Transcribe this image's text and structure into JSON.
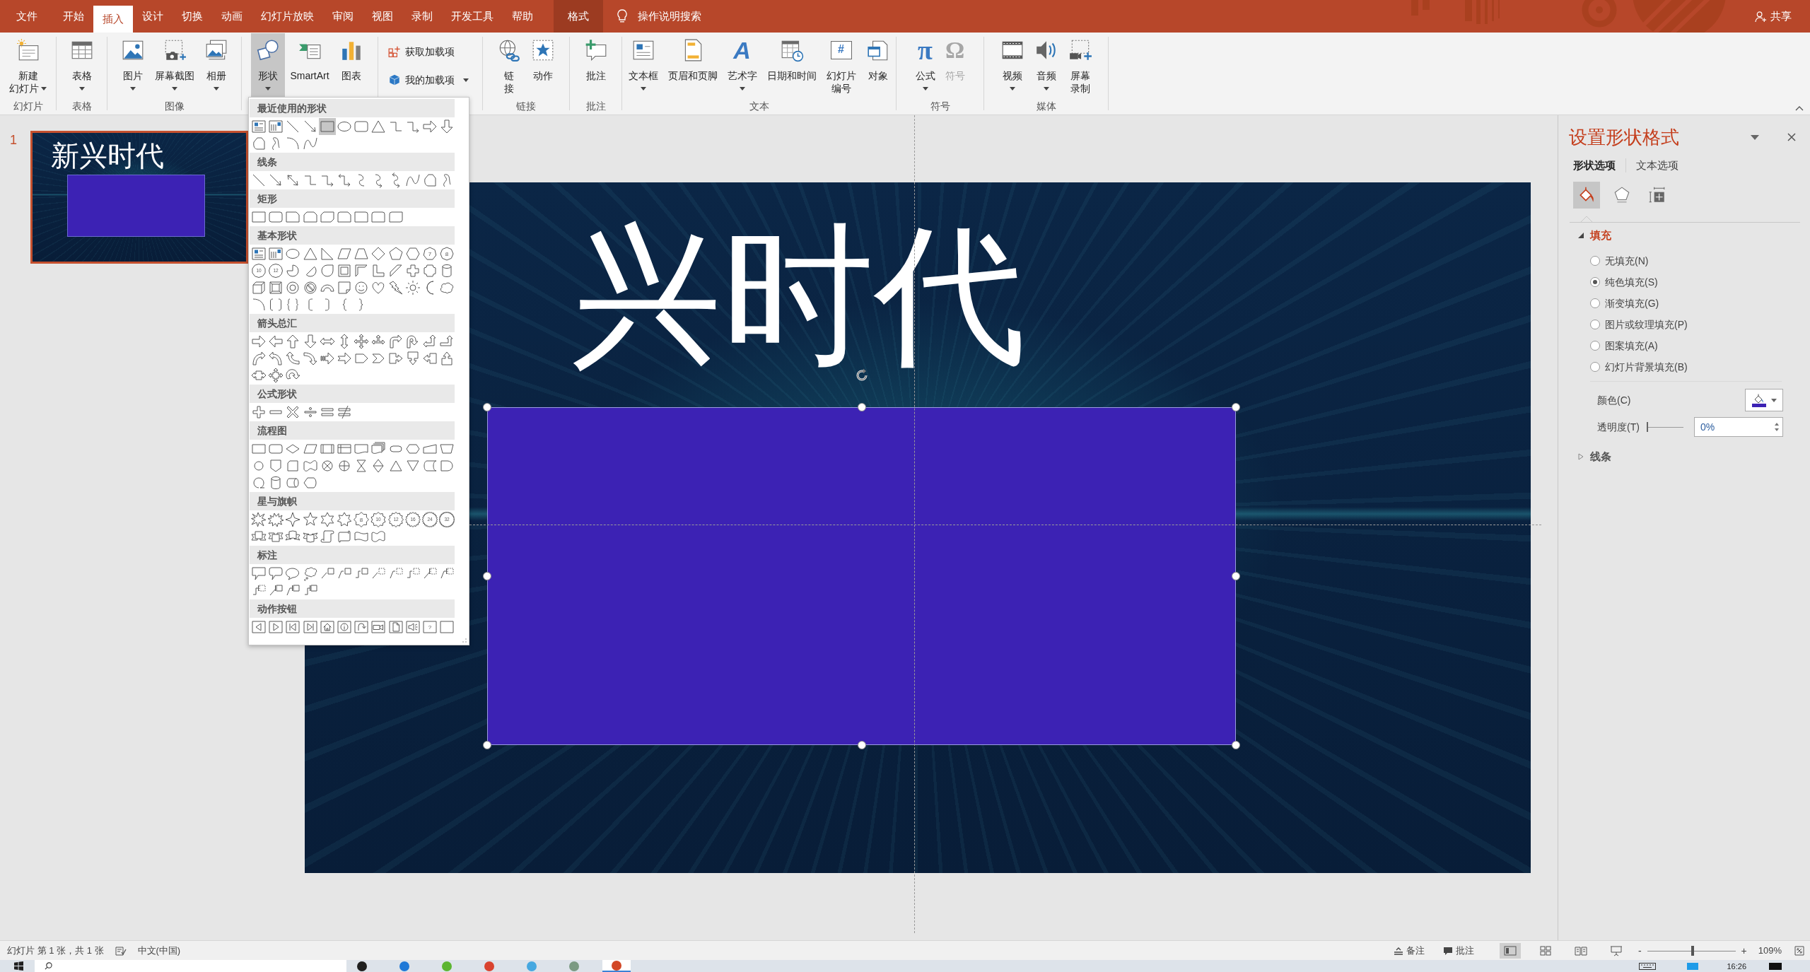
{
  "menu_tabs": [
    {
      "label": "文件",
      "kind": "file",
      "selected": false
    },
    {
      "label": "开始",
      "kind": "normal",
      "selected": false
    },
    {
      "label": "插入",
      "kind": "normal",
      "selected": true
    },
    {
      "label": "设计",
      "kind": "normal",
      "selected": false
    },
    {
      "label": "切换",
      "kind": "normal",
      "selected": false
    },
    {
      "label": "动画",
      "kind": "normal",
      "selected": false
    },
    {
      "label": "幻灯片放映",
      "kind": "normal",
      "selected": false
    },
    {
      "label": "审阅",
      "kind": "normal",
      "selected": false
    },
    {
      "label": "视图",
      "kind": "normal",
      "selected": false
    },
    {
      "label": "录制",
      "kind": "normal",
      "selected": false
    },
    {
      "label": "开发工具",
      "kind": "normal",
      "selected": false
    },
    {
      "label": "帮助",
      "kind": "normal",
      "selected": false
    },
    {
      "label": "格式",
      "kind": "contextual",
      "selected": false
    }
  ],
  "tell_me": "操作说明搜索",
  "share": "共享",
  "ribbon_groups": [
    {
      "label": "幻灯片",
      "items": [
        {
          "kind": "new_slide",
          "lines": [
            "新建",
            "幻灯片"
          ],
          "dropdown": true,
          "pressed": false,
          "disabled": false
        }
      ]
    },
    {
      "label": "表格",
      "items": [
        {
          "kind": "table",
          "lines": [
            "表格"
          ],
          "dropdown": true,
          "pressed": false,
          "disabled": false
        }
      ]
    },
    {
      "label": "图像",
      "items": [
        {
          "kind": "picture",
          "lines": [
            "图片"
          ],
          "dropdown": true,
          "pressed": false,
          "disabled": false
        },
        {
          "kind": "screenshot",
          "lines": [
            "屏幕截图"
          ],
          "dropdown": true,
          "pressed": false,
          "disabled": false
        },
        {
          "kind": "album",
          "lines": [
            "相册"
          ],
          "dropdown": true,
          "pressed": false,
          "disabled": false
        }
      ]
    },
    {
      "items": [
        {
          "kind": "shapes",
          "lines": [
            "形状"
          ],
          "dropdown": true,
          "pressed": true,
          "disabled": false
        },
        {
          "kind": "smartart",
          "lines": [
            "SmartArt"
          ],
          "dropdown": false,
          "pressed": false,
          "disabled": false
        },
        {
          "kind": "chart",
          "lines": [
            "图表"
          ],
          "dropdown": false,
          "pressed": false,
          "disabled": false
        }
      ]
    },
    {
      "items": [
        {
          "kind": "store",
          "lines": [
            "获取加载项"
          ],
          "dropdown": false,
          "pressed": false,
          "disabled": false
        },
        {
          "kind": "addins",
          "lines": [
            "我的加载项"
          ],
          "dropdown": true,
          "pressed": false,
          "disabled": false
        }
      ]
    },
    {
      "label": "链接",
      "items": [
        {
          "kind": "link",
          "lines": [
            "链",
            "接"
          ],
          "dropdown": false,
          "pressed": false,
          "disabled": false
        },
        {
          "kind": "action",
          "lines": [
            "动作"
          ],
          "dropdown": false,
          "pressed": false,
          "disabled": false
        }
      ]
    },
    {
      "label": "批注",
      "items": [
        {
          "kind": "comment",
          "lines": [
            "批注"
          ],
          "dropdown": false,
          "pressed": false,
          "disabled": false
        }
      ]
    },
    {
      "label": "文本",
      "items": [
        {
          "kind": "textbox",
          "lines": [
            "文本框"
          ],
          "dropdown": true,
          "pressed": false,
          "disabled": false
        },
        {
          "kind": "header_footer",
          "lines": [
            "页眉和页脚"
          ],
          "dropdown": false,
          "pressed": false,
          "disabled": false
        },
        {
          "kind": "wordart",
          "glyph": "A",
          "lines": [
            "艺术字"
          ],
          "dropdown": true,
          "pressed": false,
          "disabled": false
        },
        {
          "kind": "datetime",
          "lines": [
            "日期和时间"
          ],
          "dropdown": false,
          "pressed": false,
          "disabled": false
        },
        {
          "kind": "slide_number",
          "glyph": "#",
          "lines": [
            "幻灯片",
            "编号"
          ],
          "dropdown": false,
          "pressed": false,
          "disabled": false
        },
        {
          "kind": "object",
          "lines": [
            "对象"
          ],
          "dropdown": false,
          "pressed": false,
          "disabled": false
        }
      ]
    },
    {
      "label": "符号",
      "items": [
        {
          "kind": "equation",
          "glyph": "π",
          "lines": [
            "公式"
          ],
          "dropdown": true,
          "pressed": false,
          "disabled": false
        },
        {
          "kind": "symbol",
          "glyph": "Ω",
          "lines": [
            "符号"
          ],
          "dropdown": false,
          "pressed": false,
          "disabled": true
        }
      ]
    },
    {
      "label": "媒体",
      "items": [
        {
          "kind": "video",
          "lines": [
            "视频"
          ],
          "dropdown": true,
          "pressed": false,
          "disabled": false
        },
        {
          "kind": "audio",
          "lines": [
            "音频"
          ],
          "dropdown": true,
          "pressed": false,
          "disabled": false
        },
        {
          "kind": "screen_recording",
          "lines": [
            "屏幕",
            "录制"
          ],
          "dropdown": false,
          "pressed": false,
          "disabled": false
        }
      ]
    }
  ],
  "gallery": {
    "sections": [
      {
        "title": "最近使用的形状",
        "shapes": [
          {
            "kind": "textbox",
            "selected": false
          },
          {
            "kind": "vtextbox",
            "selected": false
          },
          {
            "kind": "line",
            "selected": false
          },
          {
            "kind": "arrowline",
            "selected": false
          },
          {
            "kind": "rect",
            "selected": true
          },
          {
            "kind": "oval",
            "selected": false
          },
          {
            "kind": "roundrect",
            "selected": false
          },
          {
            "kind": "triangle",
            "selected": false
          },
          {
            "kind": "elbow",
            "selected": false
          },
          {
            "kind": "elbowarrow",
            "selected": false
          },
          {
            "kind": "arrowright",
            "selected": false
          },
          {
            "kind": "arrowdown",
            "selected": false
          },
          {
            "kind": "freeform",
            "selected": false
          },
          {
            "kind": "scribble",
            "selected": false
          },
          {
            "kind": "arc",
            "selected": false
          },
          {
            "kind": "curve",
            "selected": false
          }
        ]
      },
      {
        "title": "线条",
        "shapes": [
          {
            "kind": "line"
          },
          {
            "kind": "arrowline"
          },
          {
            "kind": "dblarrowline"
          },
          {
            "kind": "elbow"
          },
          {
            "kind": "elbowarrow"
          },
          {
            "kind": "elbowdbl"
          },
          {
            "kind": "curveconn"
          },
          {
            "kind": "curvearrow"
          },
          {
            "kind": "curvedbl"
          },
          {
            "kind": "curve"
          },
          {
            "kind": "freeform"
          },
          {
            "kind": "scribble"
          }
        ]
      },
      {
        "title": "矩形",
        "shapes": [
          {
            "kind": "rect"
          },
          {
            "kind": "roundrect"
          },
          {
            "kind": "snip1"
          },
          {
            "kind": "snip2"
          },
          {
            "kind": "snipdiag"
          },
          {
            "kind": "sniprnd"
          },
          {
            "kind": "round1"
          },
          {
            "kind": "round2"
          },
          {
            "kind": "rounddiag"
          }
        ]
      },
      {
        "title": "基本形状",
        "shapes": [
          {
            "kind": "textbox"
          },
          {
            "kind": "vtextbox"
          },
          {
            "kind": "oval"
          },
          {
            "kind": "triangle"
          },
          {
            "kind": "rtriangle"
          },
          {
            "kind": "parallelogram"
          },
          {
            "kind": "trapezoid"
          },
          {
            "kind": "diamond"
          },
          {
            "kind": "pentagon"
          },
          {
            "kind": "hexagon"
          },
          {
            "kind": "heptagon",
            "label": "7"
          },
          {
            "kind": "octagon",
            "label": "8"
          },
          {
            "kind": "decagon",
            "label": "10"
          },
          {
            "kind": "dodecagon",
            "label": "12"
          },
          {
            "kind": "pie"
          },
          {
            "kind": "chord"
          },
          {
            "kind": "teardrop"
          },
          {
            "kind": "frame"
          },
          {
            "kind": "halfframe"
          },
          {
            "kind": "lshape"
          },
          {
            "kind": "diagstripe"
          },
          {
            "kind": "cross"
          },
          {
            "kind": "plaque"
          },
          {
            "kind": "can"
          },
          {
            "kind": "cube"
          },
          {
            "kind": "bevel"
          },
          {
            "kind": "donut"
          },
          {
            "kind": "nosymbol"
          },
          {
            "kind": "blockarc"
          },
          {
            "kind": "foldedcorner"
          },
          {
            "kind": "smiley"
          },
          {
            "kind": "heart"
          },
          {
            "kind": "lightning"
          },
          {
            "kind": "sun"
          },
          {
            "kind": "moon"
          },
          {
            "kind": "cloud"
          },
          {
            "kind": "arc"
          },
          {
            "kind": "bracketpair"
          },
          {
            "kind": "bracepair"
          },
          {
            "kind": "lbracket"
          },
          {
            "kind": "rbracket"
          },
          {
            "kind": "lbrace"
          },
          {
            "kind": "rbrace"
          }
        ]
      },
      {
        "title": "箭头总汇",
        "shapes": [
          {
            "kind": "arrowright"
          },
          {
            "kind": "arrowleft"
          },
          {
            "kind": "arrowup"
          },
          {
            "kind": "arrowdown"
          },
          {
            "kind": "arrowlr"
          },
          {
            "kind": "arrowud"
          },
          {
            "kind": "arrowquad"
          },
          {
            "kind": "arrowlru"
          },
          {
            "kind": "bentarrow"
          },
          {
            "kind": "uturn"
          },
          {
            "kind": "leftup"
          },
          {
            "kind": "bentup"
          },
          {
            "kind": "curvedright"
          },
          {
            "kind": "curvedleft"
          },
          {
            "kind": "curvedup"
          },
          {
            "kind": "curveddown"
          },
          {
            "kind": "striped"
          },
          {
            "kind": "notched"
          },
          {
            "kind": "homeplate"
          },
          {
            "kind": "chevron"
          },
          {
            "kind": "calloutright"
          },
          {
            "kind": "calloutdown"
          },
          {
            "kind": "calloutleft"
          },
          {
            "kind": "calloutup"
          },
          {
            "kind": "calloutlr"
          },
          {
            "kind": "calloutquad"
          },
          {
            "kind": "circulararrow"
          }
        ]
      },
      {
        "title": "公式形状",
        "shapes": [
          {
            "kind": "plus"
          },
          {
            "kind": "minus"
          },
          {
            "kind": "multiply"
          },
          {
            "kind": "divide"
          },
          {
            "kind": "equal"
          },
          {
            "kind": "notequal"
          }
        ]
      },
      {
        "title": "流程图",
        "shapes": [
          {
            "kind": "process"
          },
          {
            "kind": "altprocess"
          },
          {
            "kind": "decision"
          },
          {
            "kind": "data"
          },
          {
            "kind": "predefined"
          },
          {
            "kind": "internal"
          },
          {
            "kind": "document"
          },
          {
            "kind": "multidoc"
          },
          {
            "kind": "terminator"
          },
          {
            "kind": "preparation"
          },
          {
            "kind": "manualinput"
          },
          {
            "kind": "manualop"
          },
          {
            "kind": "connector"
          },
          {
            "kind": "offpage"
          },
          {
            "kind": "card"
          },
          {
            "kind": "punchedtape"
          },
          {
            "kind": "summing"
          },
          {
            "kind": "or"
          },
          {
            "kind": "collate"
          },
          {
            "kind": "sort"
          },
          {
            "kind": "extract"
          },
          {
            "kind": "merge"
          },
          {
            "kind": "storeddata"
          },
          {
            "kind": "delay"
          },
          {
            "kind": "sequential"
          },
          {
            "kind": "magdisk"
          },
          {
            "kind": "directaccess"
          },
          {
            "kind": "display"
          }
        ]
      },
      {
        "title": "星与旗帜",
        "shapes": [
          {
            "kind": "explosion1"
          },
          {
            "kind": "explosion2"
          },
          {
            "kind": "star4"
          },
          {
            "kind": "star5"
          },
          {
            "kind": "star6"
          },
          {
            "kind": "star7"
          },
          {
            "kind": "seal8",
            "label": "8"
          },
          {
            "kind": "seal10",
            "label": "10"
          },
          {
            "kind": "seal12",
            "label": "12"
          },
          {
            "kind": "seal16",
            "label": "16"
          },
          {
            "kind": "seal24",
            "label": "24"
          },
          {
            "kind": "seal32",
            "label": "32"
          },
          {
            "kind": "ribbondown"
          },
          {
            "kind": "ribbonup"
          },
          {
            "kind": "curvedribbondown"
          },
          {
            "kind": "curvedribbonup"
          },
          {
            "kind": "vscroll"
          },
          {
            "kind": "hscroll"
          },
          {
            "kind": "wave"
          },
          {
            "kind": "doublewave"
          }
        ]
      },
      {
        "title": "标注",
        "shapes": [
          {
            "kind": "rectcallout"
          },
          {
            "kind": "roundcallout"
          },
          {
            "kind": "ovalcallout"
          },
          {
            "kind": "cloudcallout"
          },
          {
            "kind": "lc1"
          },
          {
            "kind": "lc2"
          },
          {
            "kind": "lc3"
          },
          {
            "kind": "lcd1"
          },
          {
            "kind": "lcd2"
          },
          {
            "kind": "lcd3"
          },
          {
            "kind": "lcb1"
          },
          {
            "kind": "lcb2"
          },
          {
            "kind": "lcb3"
          },
          {
            "kind": "lca1"
          },
          {
            "kind": "lca2"
          },
          {
            "kind": "lca3"
          }
        ]
      },
      {
        "title": "动作按钮",
        "shapes": [
          {
            "kind": "actback"
          },
          {
            "kind": "actforward"
          },
          {
            "kind": "actbegin"
          },
          {
            "kind": "actend"
          },
          {
            "kind": "acthome"
          },
          {
            "kind": "actinfo"
          },
          {
            "kind": "actreturn"
          },
          {
            "kind": "actmovie"
          },
          {
            "kind": "actdoc"
          },
          {
            "kind": "actsound"
          },
          {
            "kind": "acthelp",
            "label": "?"
          },
          {
            "kind": "actcustom"
          }
        ]
      }
    ]
  },
  "slide_thumbnails": [
    {
      "number": "1",
      "title": "新兴时代",
      "selected": true
    }
  ],
  "slide": {
    "title": "兴时代",
    "shape": {
      "selected": true
    }
  },
  "format_pane": {
    "title": "设置形状格式",
    "tabs": [
      {
        "label": "形状选项",
        "selected": true
      },
      {
        "label": "文本选项",
        "selected": false
      }
    ],
    "icon_tabs": [
      {
        "kind": "fill",
        "selected": true
      },
      {
        "kind": "effects",
        "selected": false
      },
      {
        "kind": "size",
        "selected": false
      }
    ],
    "sections": [
      {
        "title": "填充",
        "expanded": true,
        "options": [
          {
            "label": "无填充(N)",
            "selected": false
          },
          {
            "label": "纯色填充(S)",
            "selected": true
          },
          {
            "label": "渐变填充(G)",
            "selected": false
          },
          {
            "label": "图片或纹理填充(P)",
            "selected": false
          },
          {
            "label": "图案填充(A)",
            "selected": false
          },
          {
            "label": "幻灯片背景填充(B)",
            "selected": false
          }
        ],
        "color_label": "颜色(C)",
        "color": "#3c22b4",
        "transparency_label": "透明度(T)",
        "transparency": {
          "level": 0,
          "value": "0%"
        }
      },
      {
        "title": "线条",
        "expanded": false
      }
    ]
  },
  "status_bar": {
    "slide_info": "幻灯片 第 1 张，共 1 张",
    "language": "中文(中国)",
    "notes": "备注",
    "comments": "批注",
    "views": [
      {
        "kind": "normal",
        "selected": true
      },
      {
        "kind": "sorter",
        "selected": false
      },
      {
        "kind": "reading",
        "selected": false
      },
      {
        "kind": "slideshow",
        "selected": false
      }
    ],
    "zoom": {
      "minus": "-",
      "plus": "+",
      "level": 0.52,
      "value": "109%"
    }
  },
  "taskbar": {
    "apps": [
      {
        "color": "#1f1f1f",
        "selected": false
      },
      {
        "color": "#1e78d7",
        "selected": false
      },
      {
        "color": "#5cb531",
        "selected": false
      },
      {
        "color": "#d9432f",
        "selected": false
      },
      {
        "color": "#46a8e0",
        "selected": false
      },
      {
        "color": "#7b9a83",
        "selected": false
      },
      {
        "color": "#d24726",
        "selected": true
      }
    ],
    "time": "16:26"
  }
}
